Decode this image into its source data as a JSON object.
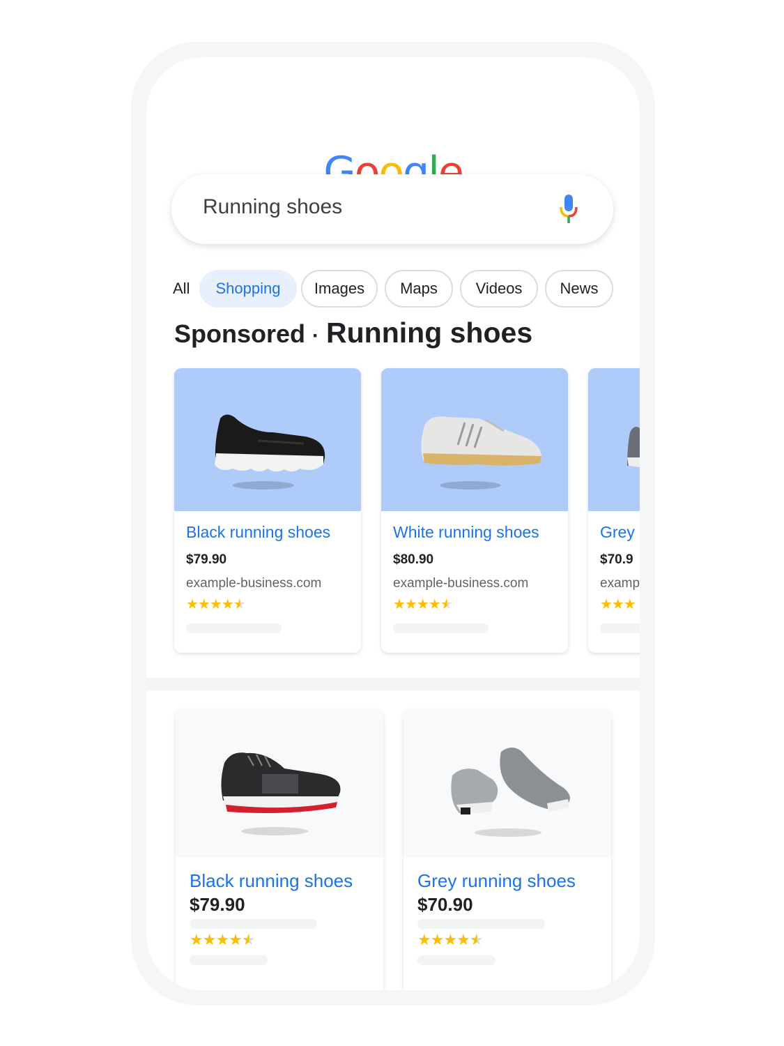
{
  "logo": {
    "letters": [
      "G",
      "o",
      "o",
      "g",
      "l",
      "e"
    ],
    "colors": [
      "#4285F4",
      "#EA4335",
      "#FBBC05",
      "#4285F4",
      "#34A853",
      "#EA4335"
    ]
  },
  "search": {
    "query": "Running shoes",
    "mic_icon": "mic-icon"
  },
  "tabs": [
    {
      "label": "All",
      "active": false
    },
    {
      "label": "Shopping",
      "active": true
    },
    {
      "label": "Images",
      "active": false
    },
    {
      "label": "Maps",
      "active": false
    },
    {
      "label": "Videos",
      "active": false
    },
    {
      "label": "News",
      "active": false
    }
  ],
  "section": {
    "sponsored": "Sponsored",
    "separator": "·",
    "title": "Running shoes"
  },
  "sponsored_products": [
    {
      "name": "Black running shoes",
      "price": "$79.90",
      "site": "example-business.com",
      "stars": "★★★★",
      "rating": 4.5,
      "image_icon": "black-sneaker-image"
    },
    {
      "name": "White running shoes",
      "price": "$80.90",
      "site": "example-business.com",
      "stars": "★★★★",
      "rating": 4.5,
      "image_icon": "white-sneaker-image"
    },
    {
      "name": "Grey",
      "price": "$70.9",
      "site": "examp",
      "stars": "★★★",
      "rating": 3,
      "image_icon": "grey-sneaker-image"
    }
  ],
  "products": [
    {
      "name": "Black running shoes",
      "price": "$79.90",
      "stars": "★★★★",
      "rating": 4.5,
      "image_icon": "black-red-sneaker-image"
    },
    {
      "name": "Grey running shoes",
      "price": "$70.90",
      "stars": "★★★★",
      "rating": 4.5,
      "image_icon": "grey-sneakers-pair-image"
    }
  ],
  "colors": {
    "accent": "#1a73e8",
    "chip_active_bg": "#e8f0fe",
    "card_image_bg": "#aecbfa",
    "star": "#fbbc04"
  }
}
